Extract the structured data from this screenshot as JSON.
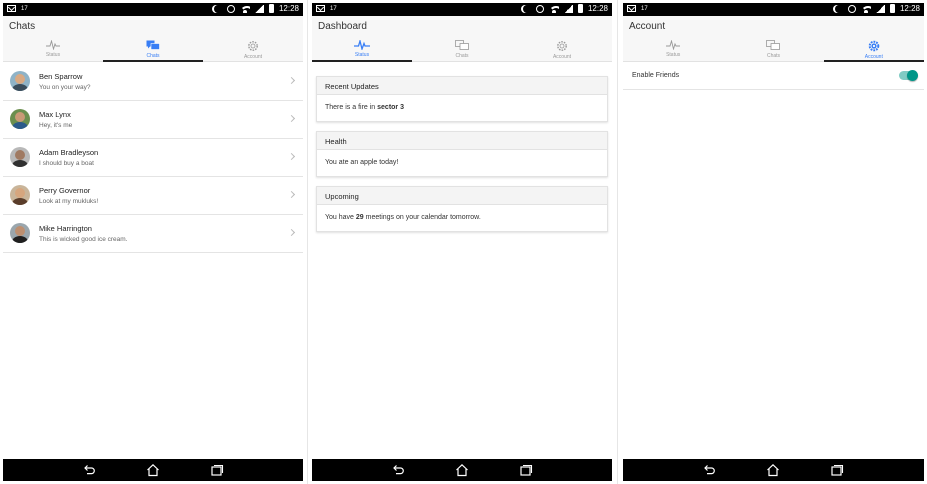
{
  "status_bar": {
    "notif_num": "17",
    "time": "12:28"
  },
  "tabs": {
    "status": "Status",
    "chats": "Chats",
    "account": "Account"
  },
  "screen_chats": {
    "title": "Chats",
    "items": [
      {
        "name": "Ben Sparrow",
        "message": "You on your way?"
      },
      {
        "name": "Max Lynx",
        "message": "Hey, it's me"
      },
      {
        "name": "Adam Bradleyson",
        "message": "I should buy a boat"
      },
      {
        "name": "Perry Governor",
        "message": "Look at my mukluks!"
      },
      {
        "name": "Mike Harrington",
        "message": "This is wicked good ice cream."
      }
    ]
  },
  "screen_dashboard": {
    "title": "Dashboard",
    "cards": [
      {
        "header": "Recent Updates",
        "body_prefix": "There is a fire in ",
        "body_bold": "sector 3",
        "body_suffix": ""
      },
      {
        "header": "Health",
        "body_prefix": "You ate an apple today!",
        "body_bold": "",
        "body_suffix": ""
      },
      {
        "header": "Upcoming",
        "body_prefix": "You have ",
        "body_bold": "29",
        "body_suffix": " meetings on your calendar tomorrow."
      }
    ]
  },
  "screen_account": {
    "title": "Account",
    "enable_friends_label": "Enable Friends",
    "enable_friends_on": true
  },
  "colors": {
    "accent": "#387ef5",
    "toggle": "#009688",
    "inactive_icon": "#999999"
  }
}
